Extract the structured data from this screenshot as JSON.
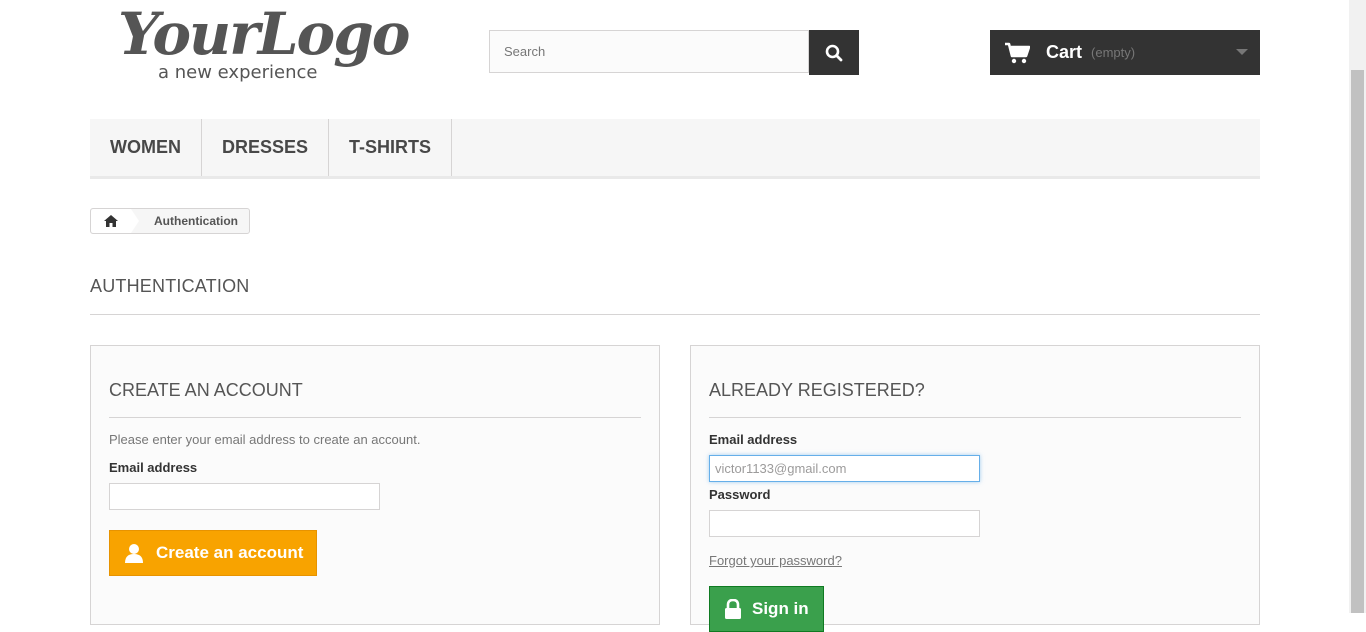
{
  "header": {
    "logo_main": "YourLogo",
    "logo_sub": "a new experience",
    "search_placeholder": "Search",
    "cart_label": "Cart",
    "cart_status": "(empty)"
  },
  "menu": {
    "items": [
      "WOMEN",
      "DRESSES",
      "T-SHIRTS"
    ]
  },
  "breadcrumb": {
    "current": "Authentication"
  },
  "page": {
    "title": "AUTHENTICATION"
  },
  "create_account": {
    "title": "CREATE AN ACCOUNT",
    "hint": "Please enter your email address to create an account.",
    "email_label": "Email address",
    "email_value": "",
    "button_label": "Create an account"
  },
  "login": {
    "title": "ALREADY REGISTERED?",
    "email_label": "Email address",
    "email_value": "victor1133@gmail.com",
    "password_label": "Password",
    "password_value": "",
    "forgot_label": "Forgot your password?",
    "button_label": "Sign in"
  },
  "colors": {
    "accent_orange": "#f8a300",
    "accent_green": "#3aa04c",
    "dark": "#333333"
  }
}
